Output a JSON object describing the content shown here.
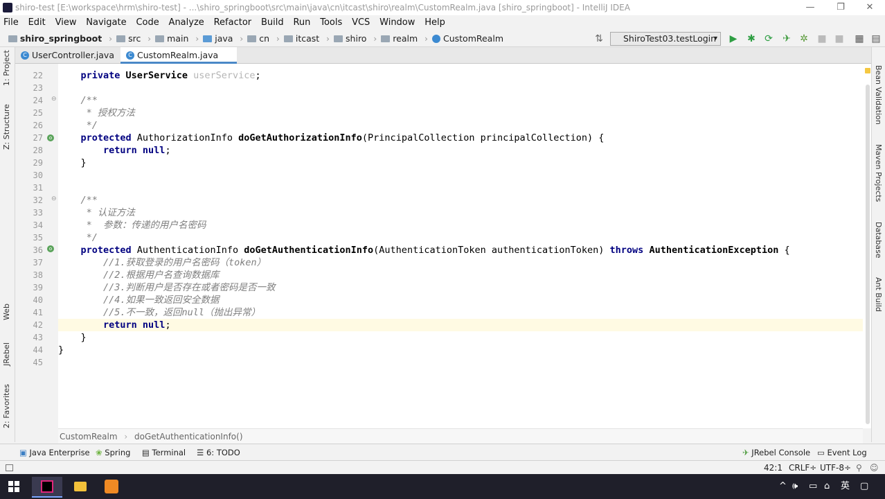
{
  "window": {
    "title": "shiro-test [E:\\workspace\\hrm\\shiro-test] - ...\\shiro_springboot\\src\\main\\java\\cn\\itcast\\shiro\\realm\\CustomRealm.java [shiro_springboot] - IntelliJ IDEA",
    "controls": [
      "—",
      "❐",
      "✕"
    ]
  },
  "menu": [
    "File",
    "Edit",
    "View",
    "Navigate",
    "Code",
    "Analyze",
    "Refactor",
    "Build",
    "Run",
    "Tools",
    "VCS",
    "Window",
    "Help"
  ],
  "breadcrumbs": [
    "shiro_springboot",
    "src",
    "main",
    "java",
    "cn",
    "itcast",
    "shiro",
    "realm",
    "CustomRealm"
  ],
  "run_config": "ShiroTest03.testLogin",
  "tabs": [
    {
      "label": "UserController.java",
      "active": false
    },
    {
      "label": "CustomRealm.java",
      "active": true
    }
  ],
  "left_tools": [
    "1: Project",
    "Z: Structure",
    "Web",
    "JRebel",
    "2: Favorites"
  ],
  "right_tools": [
    "Bean Validation",
    "Maven Projects",
    "Database",
    "Ant Build"
  ],
  "code": {
    "lines": [
      {
        "n": "22",
        "segs": [
          [
            "kw",
            "    private "
          ],
          [
            "fn",
            "UserService "
          ],
          [
            "un",
            "userService"
          ],
          [
            "ty",
            ";"
          ]
        ]
      },
      {
        "n": "23",
        "segs": []
      },
      {
        "n": "24",
        "segs": [
          [
            "cm",
            "    /**"
          ]
        ]
      },
      {
        "n": "25",
        "segs": [
          [
            "cm",
            "     * 授权方法"
          ]
        ]
      },
      {
        "n": "26",
        "segs": [
          [
            "cm",
            "     */"
          ]
        ]
      },
      {
        "n": "27",
        "segs": [
          [
            "kw",
            "    protected "
          ],
          [
            "ty",
            "AuthorizationInfo "
          ],
          [
            "fn",
            "doGetAuthorizationInfo"
          ],
          [
            "ty",
            "(PrincipalCollection principalCollection) {"
          ]
        ]
      },
      {
        "n": "28",
        "segs": [
          [
            "kw",
            "        return null"
          ],
          [
            "ty",
            ";"
          ]
        ]
      },
      {
        "n": "29",
        "segs": [
          [
            "ty",
            "    }"
          ]
        ]
      },
      {
        "n": "30",
        "segs": []
      },
      {
        "n": "31",
        "segs": []
      },
      {
        "n": "32",
        "segs": [
          [
            "cm",
            "    /**"
          ]
        ]
      },
      {
        "n": "33",
        "segs": [
          [
            "cm",
            "     * 认证方法"
          ]
        ]
      },
      {
        "n": "34",
        "segs": [
          [
            "cm",
            "     *  参数：传递的用户名密码"
          ]
        ]
      },
      {
        "n": "35",
        "segs": [
          [
            "cm",
            "     */"
          ]
        ]
      },
      {
        "n": "36",
        "segs": [
          [
            "kw",
            "    protected "
          ],
          [
            "ty",
            "AuthenticationInfo "
          ],
          [
            "fn",
            "doGetAuthenticationInfo"
          ],
          [
            "ty",
            "(AuthenticationToken authenticationToken) "
          ],
          [
            "kw",
            "throws "
          ],
          [
            "fn",
            "AuthenticationException "
          ],
          [
            "ty",
            "{"
          ]
        ]
      },
      {
        "n": "37",
        "segs": [
          [
            "cm",
            "        //1.获取登录的用户名密码（token）"
          ]
        ]
      },
      {
        "n": "38",
        "segs": [
          [
            "cm",
            "        //2.根据用户名查询数据库"
          ]
        ]
      },
      {
        "n": "39",
        "segs": [
          [
            "cm",
            "        //3.判断用户是否存在或者密码是否一致"
          ]
        ]
      },
      {
        "n": "40",
        "segs": [
          [
            "cm",
            "        //4.如果一致返回安全数据"
          ]
        ]
      },
      {
        "n": "41",
        "segs": [
          [
            "cm",
            "        //5.不一致，返回null（抛出异常）"
          ]
        ]
      },
      {
        "n": "42",
        "segs": [
          [
            "kw",
            "        return null"
          ],
          [
            "ty",
            ";"
          ]
        ]
      },
      {
        "n": "43",
        "segs": [
          [
            "ty",
            "    }"
          ]
        ]
      },
      {
        "n": "44",
        "segs": [
          [
            "ty",
            "}"
          ]
        ]
      },
      {
        "n": "45",
        "segs": []
      }
    ]
  },
  "editor_crumbs": [
    "CustomRealm",
    "doGetAuthenticationInfo()"
  ],
  "bottom_tools_left": [
    "Java Enterprise",
    "Spring",
    "Terminal",
    "6: TODO"
  ],
  "bottom_tools_right": [
    "JRebel Console",
    "Event Log"
  ],
  "status": {
    "position": "42:1",
    "line_sep": "CRLF÷",
    "encoding": "UTF-8÷"
  },
  "tray": {
    "ime": "英"
  }
}
